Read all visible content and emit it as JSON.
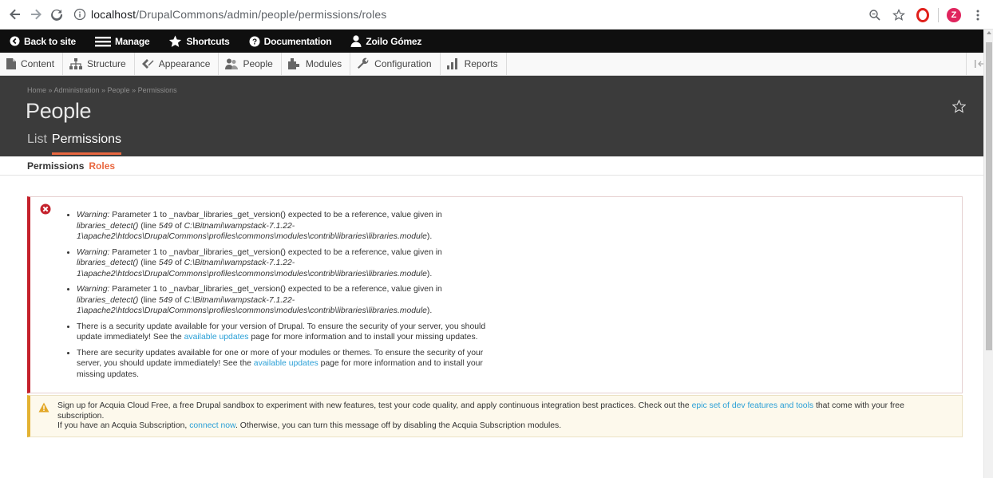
{
  "browser": {
    "url_host": "localhost",
    "url_path": "/DrupalCommons/admin/people/permissions/roles",
    "avatar_letter": "Z",
    "icons": [
      "back-arrow-icon",
      "forward-arrow-icon",
      "reload-icon",
      "info-icon",
      "zoom-icon",
      "bookmark-star-icon",
      "opera-icon",
      "menu-dots-icon"
    ]
  },
  "toolbar": {
    "back_to_site": "Back to site",
    "manage": "Manage",
    "shortcuts": "Shortcuts",
    "documentation": "Documentation",
    "user": "Zoilo Gómez"
  },
  "tray": {
    "items": [
      {
        "label": "Content",
        "icon": "content-icon"
      },
      {
        "label": "Structure",
        "icon": "structure-icon"
      },
      {
        "label": "Appearance",
        "icon": "appearance-icon"
      },
      {
        "label": "People",
        "icon": "people-icon"
      },
      {
        "label": "Modules",
        "icon": "modules-icon"
      },
      {
        "label": "Configuration",
        "icon": "configuration-icon"
      },
      {
        "label": "Reports",
        "icon": "reports-icon"
      }
    ]
  },
  "header": {
    "breadcrumb": "Home » Administration » People » Permissions",
    "title": "People",
    "tabs": [
      {
        "label": "List",
        "active": false
      },
      {
        "label": "Permissions",
        "active": true
      }
    ]
  },
  "subtabs": [
    {
      "label": "Permissions",
      "active": false
    },
    {
      "label": "Roles",
      "active": true
    }
  ],
  "errors": {
    "warning_label": "Warning:",
    "warning_text_1": " Parameter 1 to _navbar_libraries_get_version() expected to be a reference, value given in ",
    "warning_fn": "libraries_detect()",
    "warning_text_2": " (line ",
    "warning_line": "549",
    "warning_text_3": " of ",
    "warning_path": "C:\\Bitnami\\wampstack-7.1.22-1\\apache2\\htdocs\\DrupalCommons\\profiles\\commons\\modules\\contrib\\libraries\\libraries.module",
    "warning_text_4": ").",
    "security_core_1": "There is a security update available for your version of Drupal. To ensure the security of your server, you should update immediately! See the ",
    "security_core_link": "available updates",
    "security_core_2": " page for more information and to install your missing updates.",
    "security_mod_1": "There are security updates available for one or more of your modules or themes. To ensure the security of your server, you should update immediately! See the ",
    "security_mod_link": "available updates",
    "security_mod_2": " page for more information and to install your missing updates."
  },
  "warning": {
    "line1_a": "Sign up for Acquia Cloud Free, a free Drupal sandbox to experiment with new features, test your code quality, and apply continuous integration best practices. Check out the ",
    "line1_link": "epic set of dev features and tools",
    "line1_b": " that come with your free subscription.",
    "line2_a": "If you have an Acquia Subscription, ",
    "line2_link": "connect now",
    "line2_b": ". Otherwise, you can turn this message off by disabling the Acquia Subscription modules."
  },
  "colors": {
    "accent": "#e9673f",
    "error": "#c4212b",
    "warning": "#e3b232",
    "link": "#2a9fd6"
  }
}
